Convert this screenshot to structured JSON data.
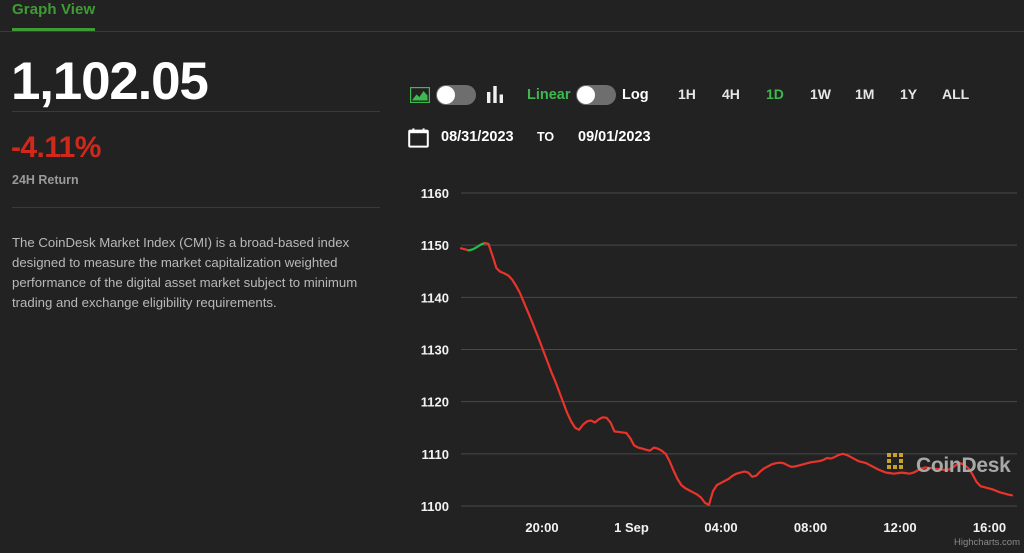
{
  "tab": {
    "label": "Graph View",
    "accent": "#3f9c35"
  },
  "summary": {
    "price": "1,102.05",
    "change": "-4.11%",
    "change_label": "24H Return",
    "change_color": "#d0291c",
    "description": "The CoinDesk Market Index (CMI) is a broad-based index designed to measure the market capitalization weighted performance of the digital asset market subject to minimum trading and exchange eligibility requirements."
  },
  "controls": {
    "chart_type_toggle": {
      "left_icon": "area-chart-icon",
      "right_icon": "bar-chart-icon",
      "state": "left"
    },
    "scale_toggle": {
      "left_label": "Linear",
      "right_label": "Log",
      "state": "left",
      "active": "Linear"
    },
    "ranges": [
      {
        "label": "1H",
        "active": false
      },
      {
        "label": "4H",
        "active": false
      },
      {
        "label": "1D",
        "active": true
      },
      {
        "label": "1W",
        "active": false
      },
      {
        "label": "1M",
        "active": false
      },
      {
        "label": "1Y",
        "active": false
      },
      {
        "label": "ALL",
        "active": false
      }
    ],
    "date_range": {
      "icon": "calendar-icon",
      "from": "08/31/2023",
      "separator": "TO",
      "to": "09/01/2023"
    }
  },
  "watermark": {
    "text": "CoinDesk",
    "logo": "coindesk-logo-icon",
    "logo_color": "#c9a227"
  },
  "chart_data": {
    "type": "line",
    "title": "",
    "xlabel": "",
    "ylabel": "",
    "ylim": [
      1095,
      1162
    ],
    "yticks": [
      1100,
      1110,
      1120,
      1130,
      1140,
      1150,
      1160
    ],
    "xticks": [
      "20:00",
      "1 Sep",
      "04:00",
      "08:00",
      "12:00",
      "16:00"
    ],
    "grid": true,
    "legend": false,
    "credit": "Highcharts.com",
    "line_color_down": "#e8342a",
    "line_color_up": "#24bd4a",
    "series": [
      {
        "name": "CoinDesk Market Index (CMI)",
        "values": [
          1149.4,
          1149.2,
          1149.0,
          1149.2,
          1149.6,
          1150.1,
          1150.4,
          1150.2,
          1148.0,
          1145.6,
          1144.9,
          1144.6,
          1144.2,
          1143.4,
          1142.2,
          1140.8,
          1139.0,
          1137.2,
          1135.4,
          1133.5,
          1131.6,
          1129.6,
          1127.6,
          1125.6,
          1123.8,
          1121.8,
          1119.8,
          1117.8,
          1116.2,
          1115.0,
          1114.6,
          1115.6,
          1116.2,
          1116.4,
          1116.0,
          1116.6,
          1117.0,
          1116.9,
          1116.0,
          1114.3,
          1114.2,
          1114.1,
          1114.0,
          1113.0,
          1111.6,
          1111.2,
          1111.0,
          1110.8,
          1110.6,
          1111.2,
          1111.0,
          1110.6,
          1110.0,
          1108.6,
          1106.8,
          1105.2,
          1104.0,
          1103.4,
          1103.0,
          1102.6,
          1102.2,
          1101.6,
          1100.6,
          1100.2,
          1102.8,
          1104.0,
          1104.4,
          1104.8,
          1105.2,
          1105.8,
          1106.2,
          1106.4,
          1106.6,
          1106.4,
          1105.6,
          1105.8,
          1106.6,
          1107.2,
          1107.6,
          1108.0,
          1108.2,
          1108.3,
          1108.2,
          1107.8,
          1107.5,
          1107.6,
          1107.8,
          1108.0,
          1108.2,
          1108.4,
          1108.5,
          1108.6,
          1108.8,
          1109.2,
          1109.1,
          1109.4,
          1109.8,
          1110.0,
          1109.8,
          1109.4,
          1109.0,
          1108.6,
          1108.4,
          1108.2,
          1107.8,
          1107.4,
          1107.0,
          1106.7,
          1106.4,
          1106.3,
          1106.2,
          1106.3,
          1106.4,
          1106.3,
          1106.2,
          1106.4,
          1106.8,
          1107.2,
          1107.4,
          1107.3,
          1107.2,
          1107.1,
          1107.0,
          1106.9,
          1107.0,
          1107.4,
          1108.0,
          1108.2,
          1107.8,
          1107.2,
          1106.0,
          1104.6,
          1103.8,
          1103.6,
          1103.4,
          1103.2,
          1102.9,
          1102.6,
          1102.4,
          1102.2,
          1102.05
        ]
      }
    ]
  }
}
